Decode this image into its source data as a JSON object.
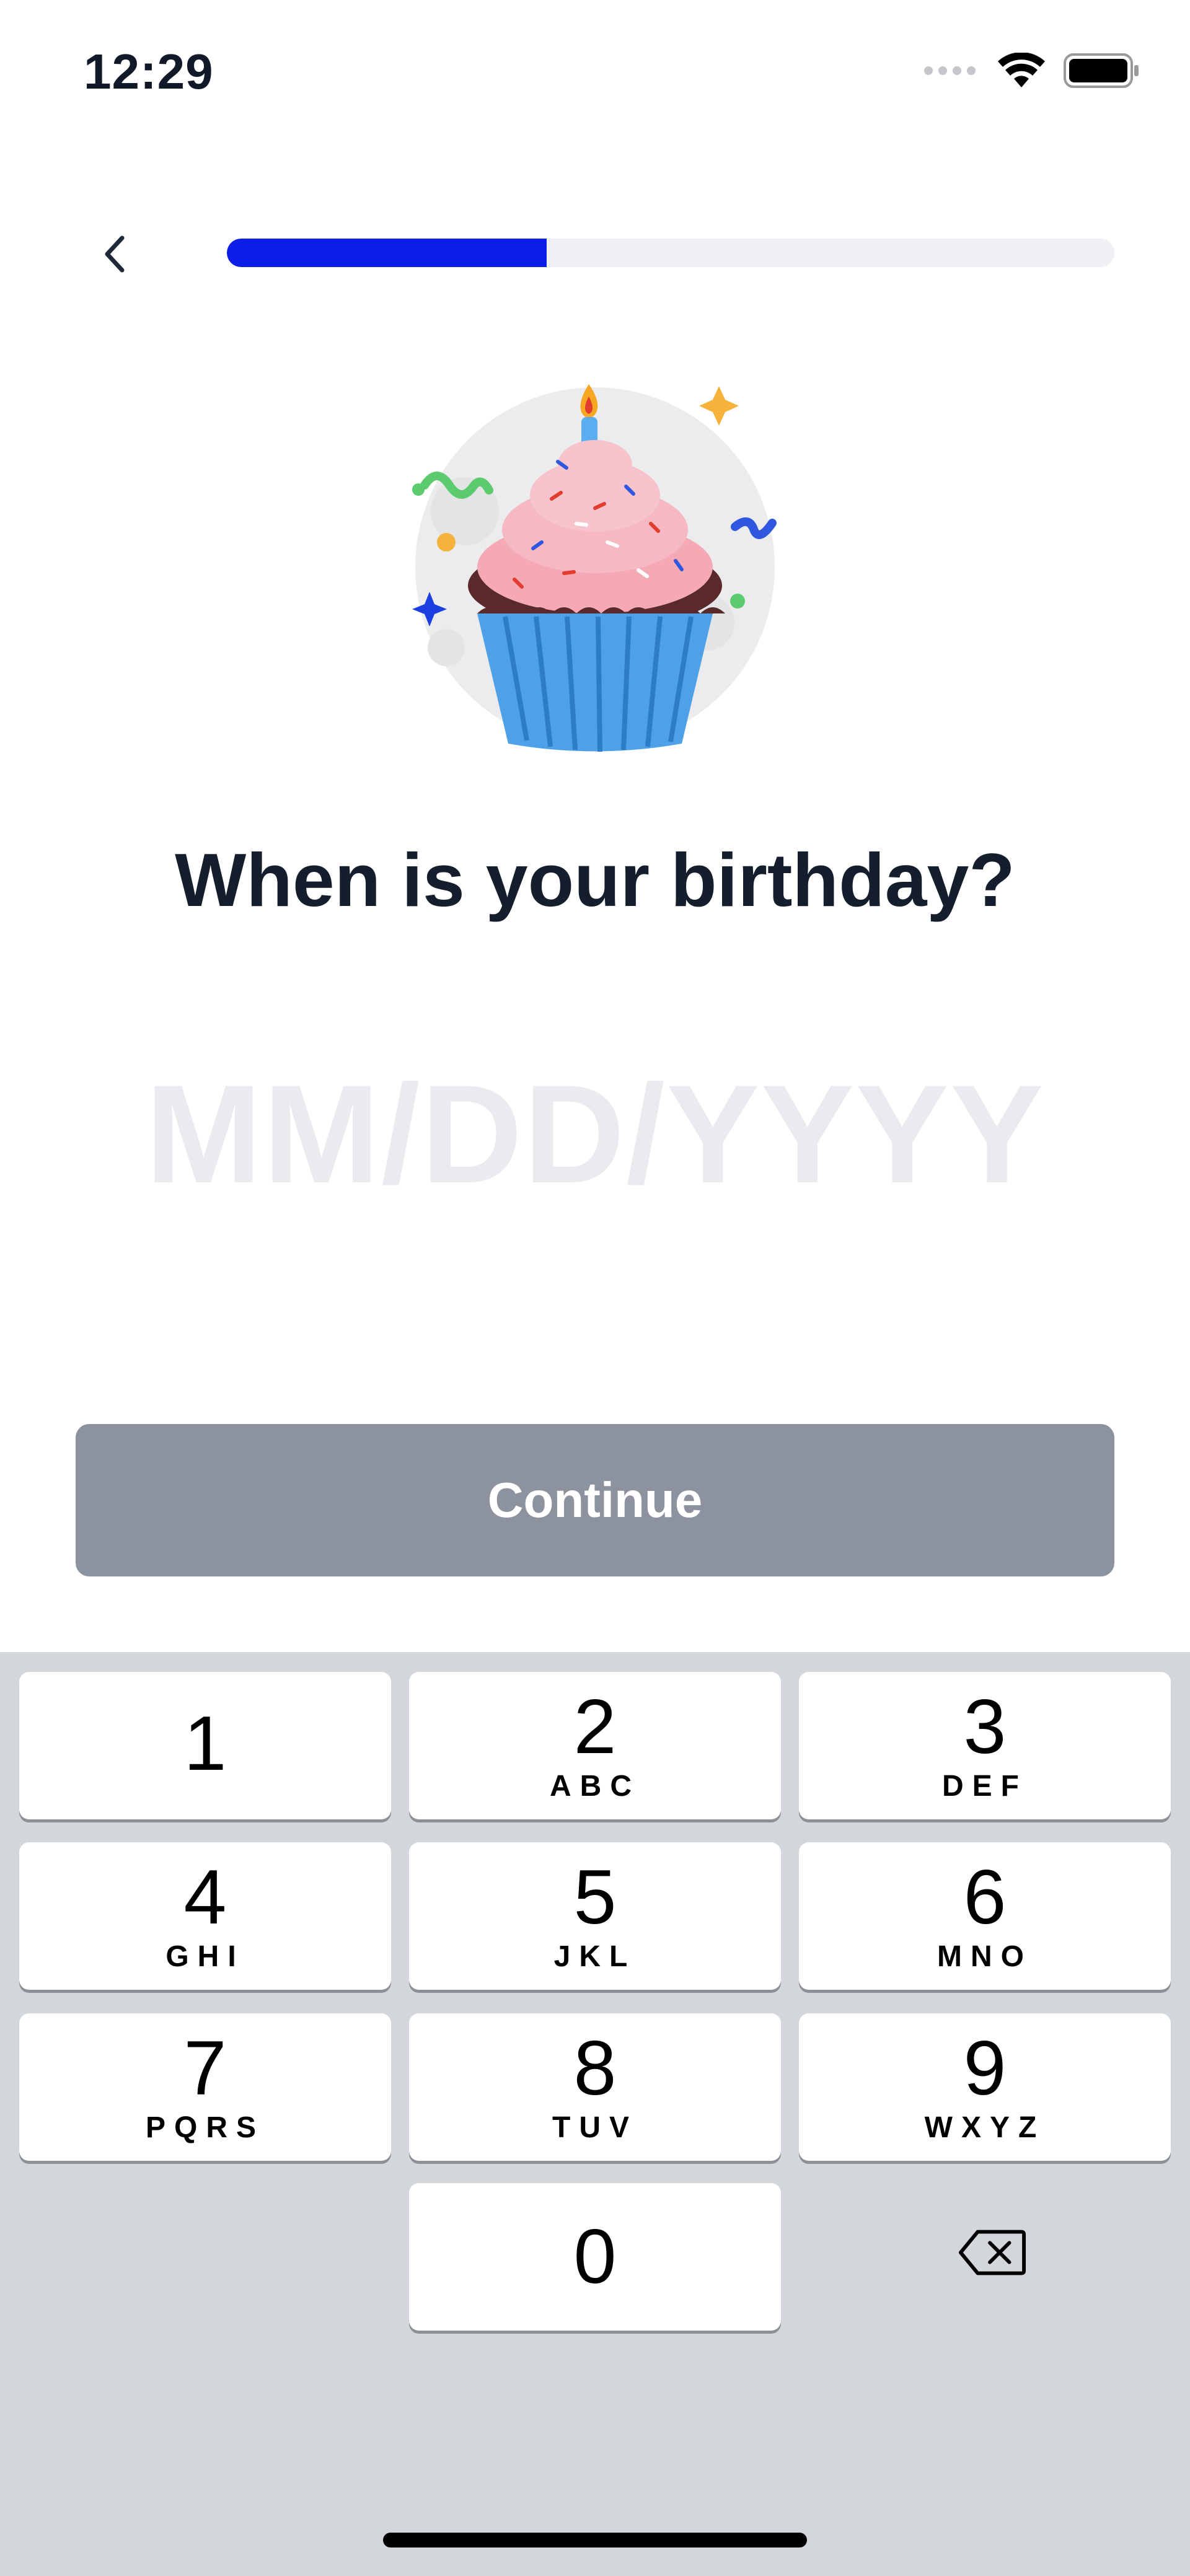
{
  "status_bar": {
    "time": "12:29",
    "icons": [
      "signal-icon",
      "wifi-icon",
      "battery-icon"
    ]
  },
  "header": {
    "back_icon": "chevron-left-icon",
    "progress": 0.36
  },
  "illustration": {
    "icon": "birthday-cupcake-icon"
  },
  "title": "When is your birthday?",
  "date_field": {
    "placeholder": "MM/DD/YYYY"
  },
  "continue_label": "Continue",
  "keypad": {
    "keys": [
      {
        "digit": "1",
        "letters": ""
      },
      {
        "digit": "2",
        "letters": "ABC"
      },
      {
        "digit": "3",
        "letters": "DEF"
      },
      {
        "digit": "4",
        "letters": "GHI"
      },
      {
        "digit": "5",
        "letters": "JKL"
      },
      {
        "digit": "6",
        "letters": "MNO"
      },
      {
        "digit": "7",
        "letters": "PQRS"
      },
      {
        "digit": "8",
        "letters": "TUV"
      },
      {
        "digit": "9",
        "letters": "WXYZ"
      },
      {
        "digit": "0",
        "letters": ""
      }
    ],
    "backspace_icon": "backspace-icon"
  },
  "colors": {
    "accent": "#0a1ee8",
    "button_disabled": "#8c939e",
    "keypad_bg": "#d3d6db",
    "placeholder": "#e9ebee"
  }
}
